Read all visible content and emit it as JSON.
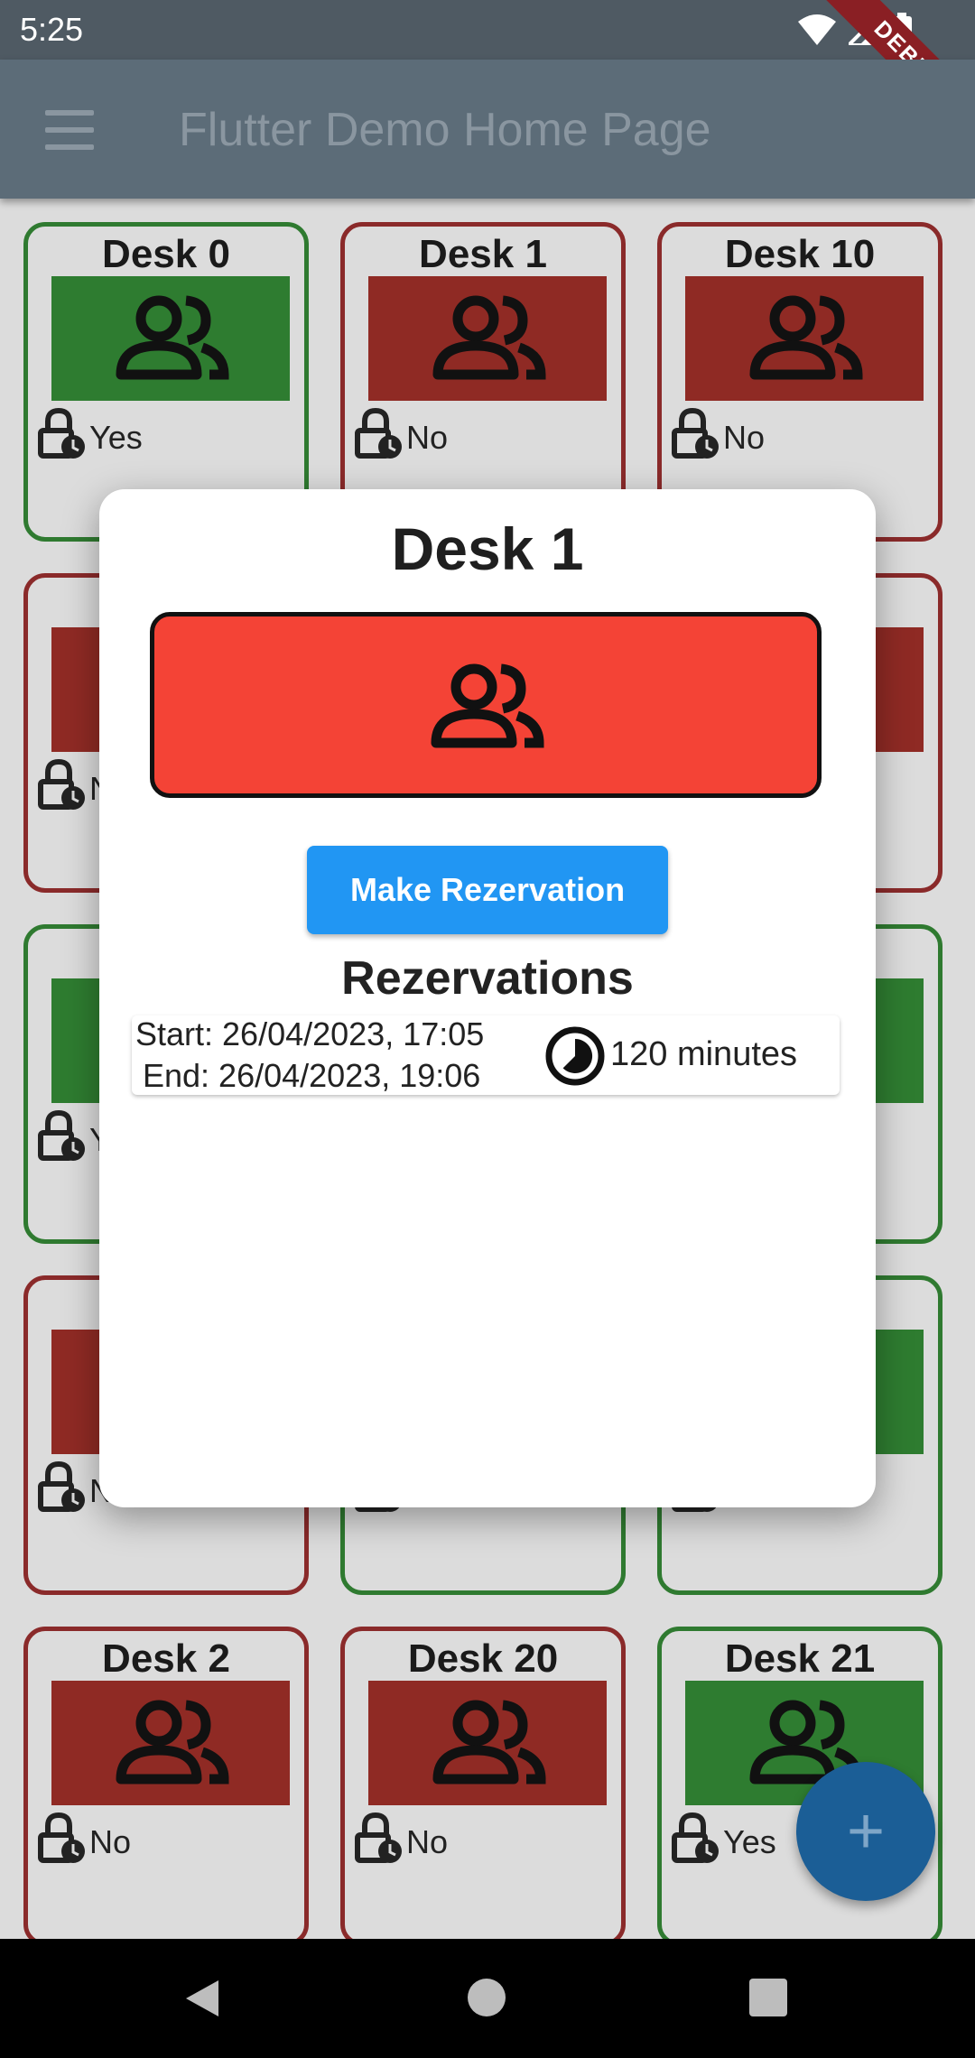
{
  "status_bar": {
    "time": "5:25",
    "debug_label": "DEBUG"
  },
  "app_bar": {
    "title": "Flutter Demo Home Page"
  },
  "colors": {
    "occupied": "#f44336",
    "available": "#2e7d32",
    "primary": "#2196f3",
    "fab": "#1565c0"
  },
  "desks": [
    {
      "name": "Desk 0",
      "available": "Yes",
      "status": "available"
    },
    {
      "name": "Desk 1",
      "available": "No",
      "status": "occupied"
    },
    {
      "name": "Desk 10",
      "available": "No",
      "status": "occupied"
    },
    {
      "name": "",
      "available": "No",
      "status": "occupied"
    },
    {
      "name": "",
      "available": "",
      "status": "occupied"
    },
    {
      "name": "",
      "available": "",
      "status": "occupied"
    },
    {
      "name": "",
      "available": "Yes",
      "status": "available"
    },
    {
      "name": "",
      "available": "",
      "status": "available"
    },
    {
      "name": "",
      "available": "",
      "status": "available"
    },
    {
      "name": "",
      "available": "No",
      "status": "occupied"
    },
    {
      "name": "",
      "available": "",
      "status": "available"
    },
    {
      "name": "",
      "available": "",
      "status": "available"
    },
    {
      "name": "Desk 2",
      "available": "No",
      "status": "occupied"
    },
    {
      "name": "Desk 20",
      "available": "No",
      "status": "occupied"
    },
    {
      "name": "Desk 21",
      "available": "Yes",
      "status": "available"
    }
  ],
  "dialog": {
    "title": "Desk 1",
    "status": "occupied",
    "make_button_label": "Make Rezervation",
    "reservations_title": "Rezervations",
    "reservations": [
      {
        "start": "Start: 26/04/2023, 17:05",
        "end": "End: 26/04/2023, 19:06",
        "duration": "120 minutes"
      }
    ]
  },
  "fab": {
    "icon": "add-icon",
    "label": "+"
  },
  "nav_bar": {
    "back": "back-icon",
    "home": "home-icon",
    "recents": "recents-icon"
  }
}
